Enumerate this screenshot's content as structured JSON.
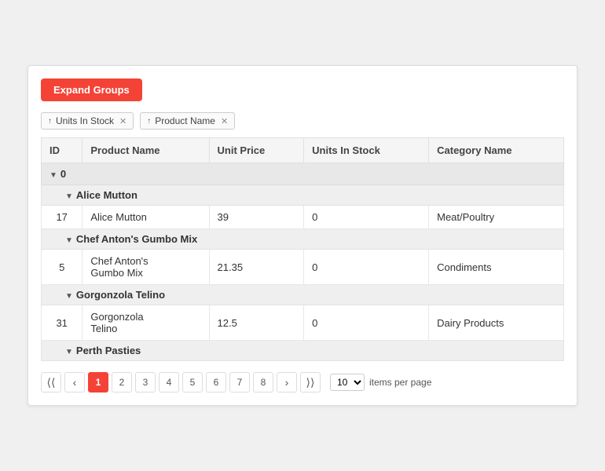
{
  "toolbar": {
    "expand_btn_label": "Expand Groups"
  },
  "group_tags": [
    {
      "label": "Units In Stock",
      "arrow": "↑"
    },
    {
      "label": "Product Name",
      "arrow": "↑"
    }
  ],
  "table": {
    "columns": [
      {
        "key": "id",
        "label": "ID"
      },
      {
        "key": "product_name",
        "label": "Product Name"
      },
      {
        "key": "unit_price",
        "label": "Unit Price"
      },
      {
        "key": "units_in_stock",
        "label": "Units In Stock"
      },
      {
        "key": "category_name",
        "label": "Category Name"
      }
    ],
    "groups": [
      {
        "level": 0,
        "label": "0",
        "children": [
          {
            "level": 1,
            "label": "Alice Mutton",
            "rows": [
              {
                "id": 17,
                "product_name": "Alice Mutton",
                "unit_price": "39",
                "units_in_stock": "0",
                "category_name": "Meat/Poultry"
              }
            ]
          },
          {
            "level": 1,
            "label": "Chef Anton's Gumbo Mix",
            "rows": [
              {
                "id": 5,
                "product_name": "Chef Anton's\nGumbo Mix",
                "unit_price": "21.35",
                "units_in_stock": "0",
                "category_name": "Condiments"
              }
            ]
          },
          {
            "level": 1,
            "label": "Gorgonzola Telino",
            "rows": [
              {
                "id": 31,
                "product_name": "Gorgonzola\nTelino",
                "unit_price": "12.5",
                "units_in_stock": "0",
                "category_name": "Dairy Products"
              }
            ]
          },
          {
            "level": 1,
            "label": "Perth Pasties",
            "rows": []
          }
        ]
      }
    ]
  },
  "pagination": {
    "pages": [
      "1",
      "2",
      "3",
      "4",
      "5",
      "6",
      "7",
      "8"
    ],
    "active_page": "1",
    "items_per_page": "10",
    "items_per_page_label": "items per page"
  }
}
